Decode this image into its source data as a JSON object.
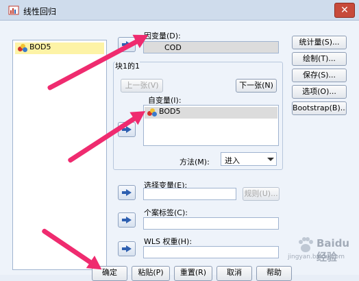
{
  "window": {
    "title": "线性回归",
    "close": "✕"
  },
  "source_list": {
    "items": [
      "BOD5"
    ]
  },
  "dependent": {
    "label": "因变量(D):",
    "value": "COD"
  },
  "block": {
    "label": "块1的1",
    "prev": "上一张(V)",
    "next": "下一张(N)"
  },
  "independent": {
    "label": "自变量(I):",
    "items": [
      "BOD5"
    ]
  },
  "method": {
    "label": "方法(M):",
    "value": "进入"
  },
  "selection": {
    "label": "选择变量(E):",
    "rule_button": "规则(U)..."
  },
  "case_label": {
    "label": "个案标签(C):"
  },
  "wls": {
    "label": "WLS 权重(H):"
  },
  "side_buttons": [
    "统计量(S)...",
    "绘制(T)...",
    "保存(S)...",
    "选项(O)...",
    "Bootstrap(B)..."
  ],
  "bottom_buttons": [
    "确定",
    "粘贴(P)",
    "重置(R)",
    "取消",
    "帮助"
  ],
  "watermark": {
    "text": "Baidu经验",
    "sub": "jingyan.baidu.com"
  },
  "colors": {
    "arrow": "#ef2b6f",
    "selected": "#fdf3a6",
    "title_bg": "#cfdcec"
  }
}
